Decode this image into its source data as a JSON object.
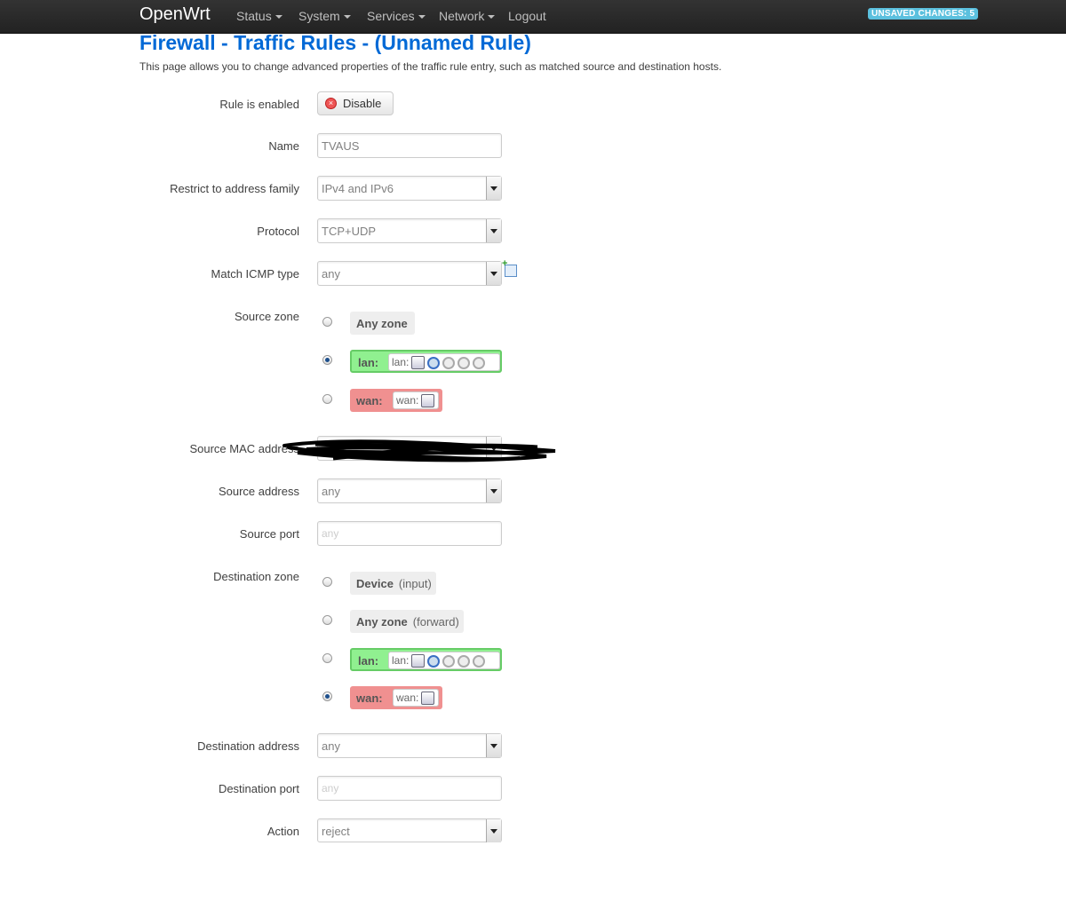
{
  "brand": "OpenWrt",
  "nav": {
    "status": "Status",
    "system": "System",
    "services": "Services",
    "network": "Network",
    "logout": "Logout"
  },
  "unsaved_badge": "UNSAVED CHANGES: 5",
  "title": "Firewall - Traffic Rules - (Unnamed Rule)",
  "description": "This page allows you to change advanced properties of the traffic rule entry, such as matched source and destination hosts.",
  "fields": {
    "rule_enabled": {
      "label": "Rule is enabled",
      "button": "Disable"
    },
    "name": {
      "label": "Name",
      "value": "TVAUS"
    },
    "family": {
      "label": "Restrict to address family",
      "value": "IPv4 and IPv6"
    },
    "protocol": {
      "label": "Protocol",
      "value": "TCP+UDP"
    },
    "icmp": {
      "label": "Match ICMP type",
      "value": "any"
    },
    "source_zone": {
      "label": "Source zone"
    },
    "source_mac": {
      "label": "Source MAC address",
      "value": ""
    },
    "source_address": {
      "label": "Source address",
      "value": "any"
    },
    "source_port": {
      "label": "Source port",
      "placeholder": "any"
    },
    "dest_zone": {
      "label": "Destination zone"
    },
    "dest_address": {
      "label": "Destination address",
      "value": "any"
    },
    "dest_port": {
      "label": "Destination port",
      "placeholder": "any"
    },
    "action": {
      "label": "Action",
      "value": "reject"
    }
  },
  "source_zones": {
    "any": {
      "name": "Any zone",
      "selected": false
    },
    "lan": {
      "name": "lan:",
      "net": "lan:",
      "selected": true
    },
    "wan": {
      "name": "wan:",
      "net": "wan:",
      "selected": false
    }
  },
  "dest_zones": {
    "device": {
      "name": "Device",
      "sub": "(input)",
      "selected": false
    },
    "any": {
      "name": "Any zone",
      "sub": "(forward)",
      "selected": false
    },
    "lan": {
      "name": "lan:",
      "net": "lan:",
      "selected": false
    },
    "wan": {
      "name": "wan:",
      "net": "wan:",
      "selected": true
    }
  },
  "colors": {
    "topbar": "#222222",
    "title": "#0069d6",
    "lan_zone": "#90f090",
    "wan_zone": "#f09090",
    "badge": "#5bc0de"
  }
}
